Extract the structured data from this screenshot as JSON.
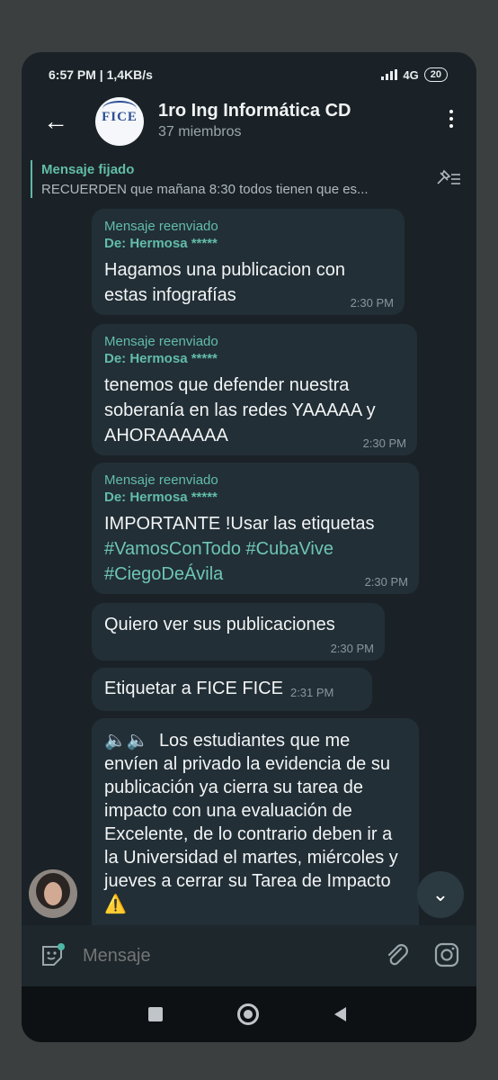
{
  "status": {
    "time_speed": "6:57 PM | 1,4KB/s",
    "network": "4G",
    "battery": "20"
  },
  "header": {
    "back_icon": "arrow-left-icon",
    "avatar_logo": "FICE",
    "title": "1ro Ing Informática CD",
    "subtitle": "37 miembros",
    "menu_icon": "more-vert-icon"
  },
  "pinned": {
    "label": "Mensaje fijado",
    "text": "RECUERDEN que mañana 8:30 todos tienen que es..."
  },
  "messages": [
    {
      "forwarded_label": "Mensaje reenviado",
      "from_label": "De: Hermosa *****",
      "text": "Hagamos una publicacion con estas infografías",
      "time": "2:30 PM"
    },
    {
      "forwarded_label": "Mensaje reenviado",
      "from_label": "De: Hermosa *****",
      "text": "tenemos que defender nuestra soberanía en las redes YAAAAA y AHORAAAAAA",
      "time": "2:30 PM"
    },
    {
      "forwarded_label": "Mensaje reenviado",
      "from_label": "De: Hermosa *****",
      "text_start": "IMPORTANTE !Usar las etiquetas ",
      "tag1": "#VamosConTodo",
      "tag2": "#CubaVive",
      "tag3": "#CiegoDeÁvila",
      "time": "2:30 PM"
    },
    {
      "text": "Quiero ver sus publicaciones",
      "time": "2:30 PM"
    },
    {
      "text": "Etiquetar a FICE FICE",
      "time": "2:31 PM"
    },
    {
      "prefix": "🔈🔈",
      "text": "Los estudiantes que me envíen al privado la evidencia de su publicación ya cierra su tarea de impacto con una evaluación de Excelente, de lo contrario deben ir a la Universidad el martes, miércoles y jueves a cerrar su Tarea de Impacto",
      "suffix": "⚠️"
    }
  ],
  "input": {
    "placeholder": "Mensaje",
    "sticker_icon": "sticker-icon",
    "attach_icon": "paperclip-icon",
    "camera_icon": "instagram-camera-icon"
  },
  "colors": {
    "accent": "#62bca8",
    "bubble": "#222f36",
    "background": "#1a2227"
  }
}
